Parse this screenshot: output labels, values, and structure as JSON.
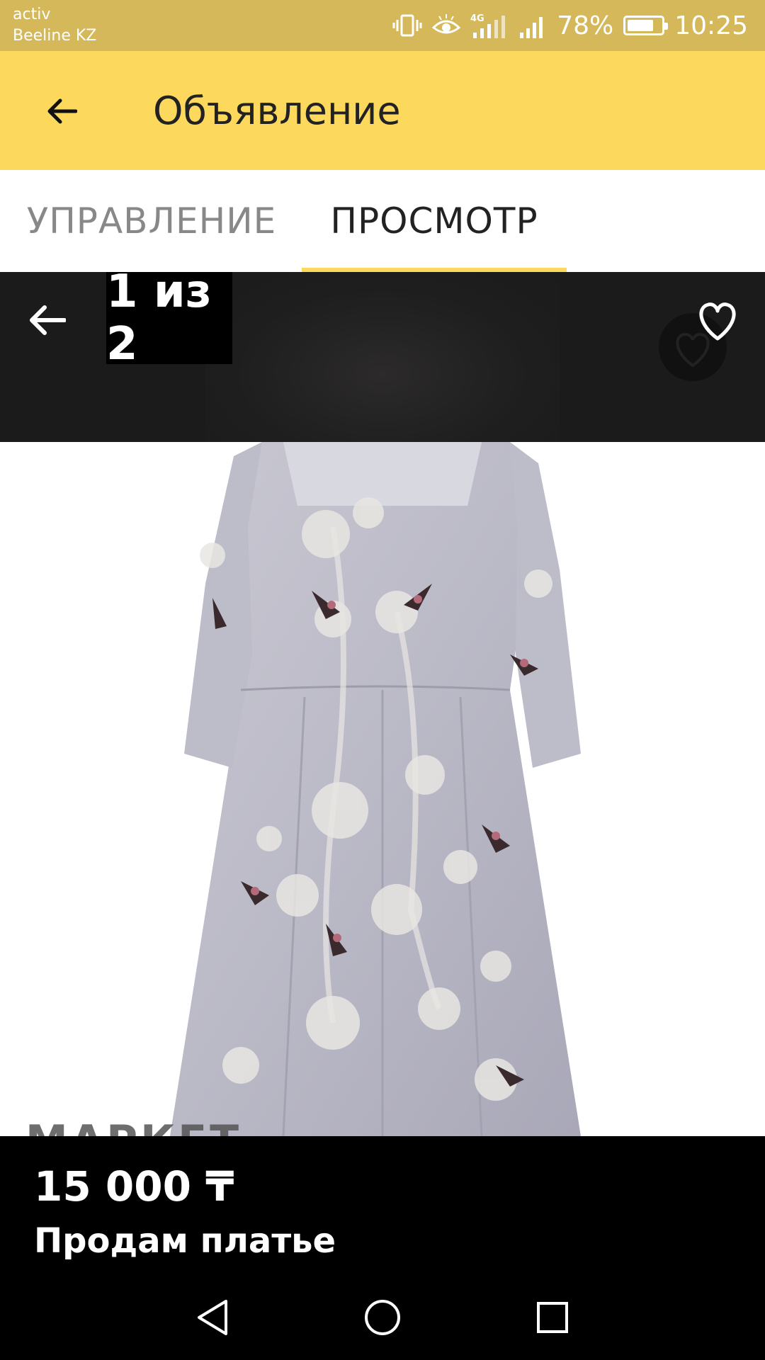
{
  "status_bar": {
    "carrier_line1": "activ",
    "carrier_line2": "Beeline KZ",
    "battery_percent": "78%",
    "battery_level": 0.78,
    "time": "10:25",
    "icons": [
      "vibrate-icon",
      "eye-icon",
      "signal-4g-icon",
      "signal-icon",
      "battery-icon"
    ]
  },
  "app_bar": {
    "title": "Объявление",
    "back_icon": "arrow-left-icon",
    "color": "#fcd95c"
  },
  "tabs": [
    {
      "label": "УПРАВЛЕНИЕ",
      "selected": false
    },
    {
      "label": "ПРОСМОТР",
      "selected": true
    }
  ],
  "gallery": {
    "counter": "1 из 2",
    "back_icon": "arrow-left-icon",
    "favorite_icon": "heart-outline-icon",
    "watermark": "МАРКЕТ"
  },
  "listing": {
    "price": "15 000 ₸",
    "title": "Продам платье"
  },
  "nav_bar": {
    "buttons": [
      "back-triangle-icon",
      "home-circle-icon",
      "recents-square-icon"
    ]
  }
}
